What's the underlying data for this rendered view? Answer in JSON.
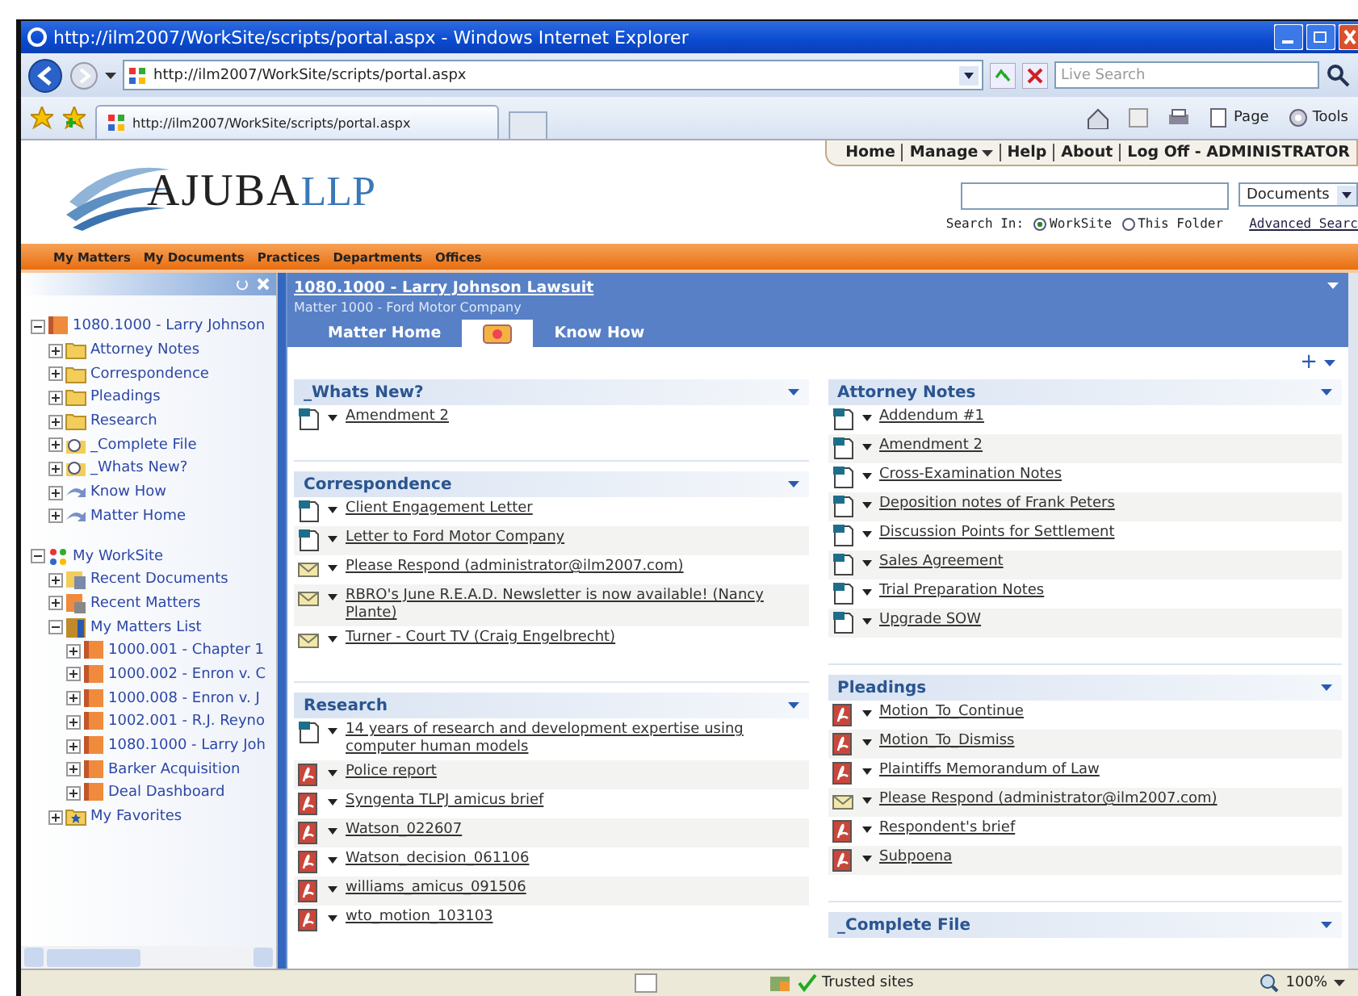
{
  "window": {
    "title": "http://ilm2007/WorkSite/scripts/portal.aspx - Windows Internet Explorer"
  },
  "address_bar": {
    "url": "http://ilm2007/WorkSite/scripts/portal.aspx",
    "search_placeholder": "Live Search"
  },
  "browser_tab": {
    "label": "http://ilm2007/WorkSite/scripts/portal.aspx"
  },
  "command_bar": [
    "Page",
    "Tools"
  ],
  "site": {
    "logo": "AJUBA",
    "logo_suffix": "LLP",
    "header_links": [
      {
        "label": "Home",
        "dropdown": false
      },
      {
        "label": "Manage",
        "dropdown": true
      },
      {
        "label": "Help",
        "dropdown": false
      },
      {
        "label": "About",
        "dropdown": false
      },
      {
        "label": "Log Off - ADMINISTRATOR",
        "dropdown": false
      }
    ],
    "search": {
      "scope_value": "Documents",
      "search_in_label": "Search In:",
      "options": [
        {
          "label": "WorkSite",
          "selected": true
        },
        {
          "label": "This Folder",
          "selected": false
        }
      ],
      "advanced_link": "Advanced Searc"
    },
    "nav": [
      "My Matters",
      "My Documents",
      "Practices",
      "Departments",
      "Offices"
    ]
  },
  "sidebar": {
    "tree": [
      {
        "label": "1080.1000 - Larry Johnson",
        "kind": "matter",
        "expanded": true,
        "children": [
          {
            "label": "Attorney Notes",
            "kind": "folder",
            "expanded": false
          },
          {
            "label": "Correspondence",
            "kind": "folder",
            "expanded": false
          },
          {
            "label": "Pleadings",
            "kind": "folder",
            "expanded": false
          },
          {
            "label": "Research",
            "kind": "folder",
            "expanded": false
          },
          {
            "label": "_Complete File",
            "kind": "search-folder",
            "expanded": false
          },
          {
            "label": "_Whats New?",
            "kind": "search-folder",
            "expanded": false
          },
          {
            "label": "Know How",
            "kind": "link",
            "expanded": false
          },
          {
            "label": "Matter Home",
            "kind": "link",
            "expanded": false
          }
        ]
      },
      {
        "label": "My WorkSite",
        "kind": "worksite",
        "expanded": true,
        "children": [
          {
            "label": "Recent Documents",
            "kind": "recent",
            "expanded": false
          },
          {
            "label": "Recent Matters",
            "kind": "recent-matter",
            "expanded": false
          },
          {
            "label": "My Matters List",
            "kind": "list",
            "expanded": true,
            "children": [
              {
                "label": "1000.001 - Chapter 1",
                "kind": "matter",
                "expanded": false
              },
              {
                "label": "1000.002 - Enron v. C",
                "kind": "matter",
                "expanded": false
              },
              {
                "label": "1000.008 - Enron v. J",
                "kind": "matter",
                "expanded": false
              },
              {
                "label": "1002.001 - R.J. Reyno",
                "kind": "matter",
                "expanded": false
              },
              {
                "label": "1080.1000 - Larry Joh",
                "kind": "matter",
                "expanded": false
              },
              {
                "label": "Barker Acquisition",
                "kind": "matter",
                "expanded": false
              },
              {
                "label": "Deal Dashboard",
                "kind": "matter",
                "expanded": false
              }
            ]
          },
          {
            "label": "My Favorites",
            "kind": "favorites",
            "expanded": false
          }
        ]
      }
    ]
  },
  "matter": {
    "title": "1080.1000 - Larry Johnson Lawsuit",
    "subtitle": "Matter 1000 - Ford Motor Company",
    "tabs": [
      {
        "kind": "text",
        "label": "Matter Home",
        "selected": false
      },
      {
        "kind": "icon",
        "selected": true
      },
      {
        "kind": "text",
        "label": "Know How",
        "selected": false
      }
    ]
  },
  "content_toolbar": {
    "add_label": "+"
  },
  "columns": [
    [
      {
        "title": "_Whats New?",
        "items": [
          {
            "kind": "word",
            "label": "Amendment 2"
          }
        ]
      },
      {
        "title": "Correspondence",
        "items": [
          {
            "kind": "word",
            "label": "Client Engagement Letter"
          },
          {
            "kind": "word",
            "label": "Letter to Ford Motor Company"
          },
          {
            "kind": "email",
            "label": "Please Respond (administrator@ilm2007.com)"
          },
          {
            "kind": "email",
            "label": "RBRO's June R.E.A.D. Newsletter is now available! (Nancy Plante)"
          },
          {
            "kind": "email",
            "label": "Turner - Court TV (Craig Engelbrecht)"
          }
        ]
      },
      {
        "title": "Research",
        "items": [
          {
            "kind": "word",
            "label": "14 years of research and development expertise using computer human models"
          },
          {
            "kind": "pdf",
            "label": "Police report"
          },
          {
            "kind": "pdf",
            "label": "Syngenta TLPJ amicus brief"
          },
          {
            "kind": "pdf",
            "label": "Watson_022607"
          },
          {
            "kind": "pdf",
            "label": "Watson_decision_061106"
          },
          {
            "kind": "pdf",
            "label": "williams_amicus_091506"
          },
          {
            "kind": "pdf",
            "label": "wto_motion_103103"
          }
        ]
      }
    ],
    [
      {
        "title": "Attorney Notes",
        "items": [
          {
            "kind": "word",
            "label": "Addendum #1"
          },
          {
            "kind": "word",
            "label": "Amendment 2"
          },
          {
            "kind": "word",
            "label": "Cross-Examination Notes"
          },
          {
            "kind": "word",
            "label": "Deposition notes of Frank Peters"
          },
          {
            "kind": "word",
            "label": "Discussion Points for Settlement"
          },
          {
            "kind": "word",
            "label": "Sales Agreement"
          },
          {
            "kind": "word",
            "label": "Trial Preparation Notes"
          },
          {
            "kind": "word",
            "label": "Upgrade SOW"
          }
        ]
      },
      {
        "title": "Pleadings",
        "items": [
          {
            "kind": "pdf",
            "label": "Motion_To_Continue"
          },
          {
            "kind": "pdf",
            "label": "Motion_To_Dismiss"
          },
          {
            "kind": "pdf",
            "label": "Plaintiffs Memorandum of Law"
          },
          {
            "kind": "email",
            "label": "Please Respond (administrator@ilm2007.com)"
          },
          {
            "kind": "pdf",
            "label": "Respondent's brief"
          },
          {
            "kind": "pdf",
            "label": "Subpoena"
          }
        ]
      },
      {
        "title": "_Complete File"
      }
    ]
  ],
  "status_bar": {
    "zone": "Trusted sites",
    "zoom": "100%"
  }
}
